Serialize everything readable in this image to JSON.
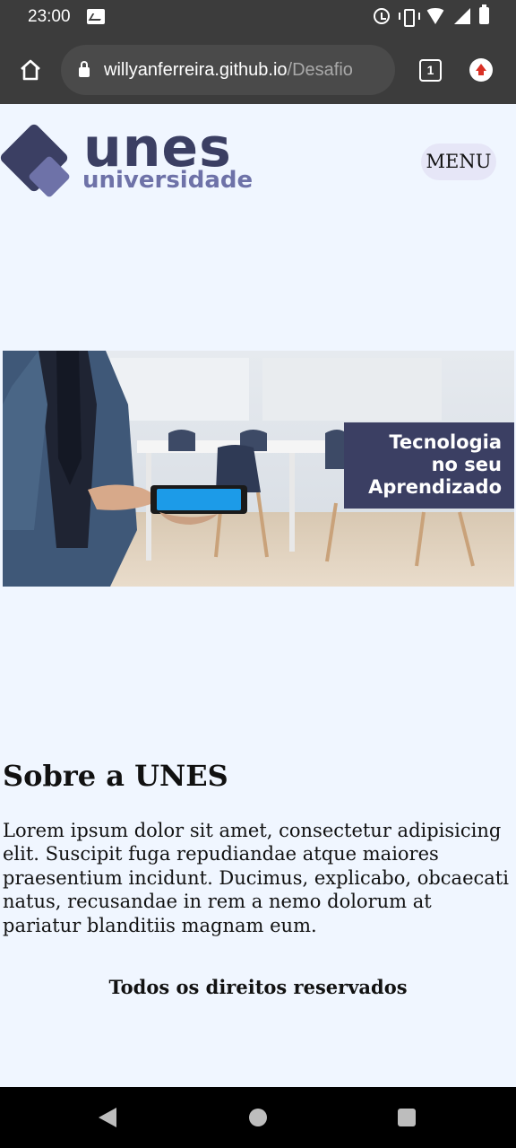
{
  "status_bar": {
    "time": "23:00"
  },
  "browser": {
    "url_host": "willyanferreira.github.io",
    "url_path": "/Desafio",
    "tab_count": "1"
  },
  "header": {
    "logo_word": "unes",
    "logo_sub": "universidade",
    "menu_label": "MENU"
  },
  "banner": {
    "tag_line1": "Tecnologia",
    "tag_line2": "no seu",
    "tag_line3": "Aprendizado"
  },
  "about": {
    "title": "Sobre a UNES",
    "text": "Lorem ipsum dolor sit amet, consectetur adipisicing elit. Suscipit fuga repudiandae atque maiores praesentium incidunt. Ducimus, explicabo, obcaecati natus, recusandae in rem a nemo dolorum at pariatur blanditiis magnam eum."
  },
  "footer": {
    "text": "Todos os direitos reservados"
  },
  "colors": {
    "page_bg": "#f0f6ff",
    "brand_dark": "#3b3f63",
    "brand_light": "#6e72a8",
    "menu_bg": "#e6e6f7"
  }
}
